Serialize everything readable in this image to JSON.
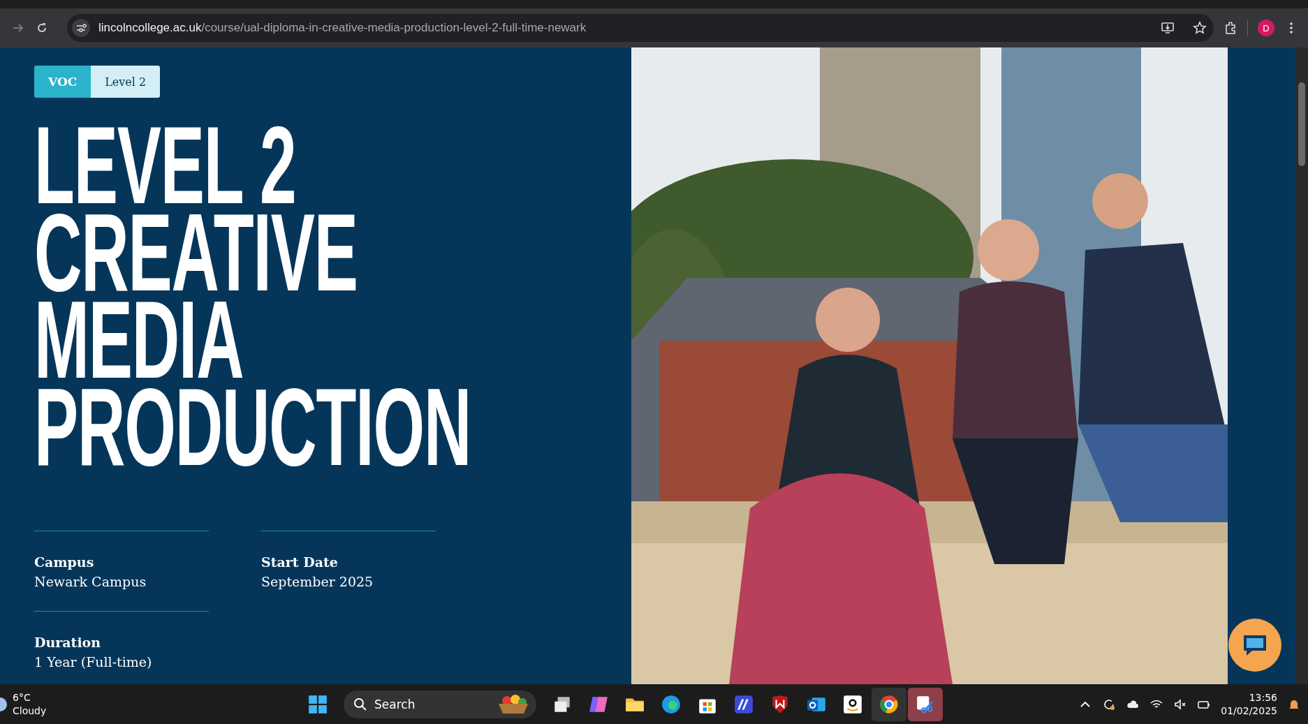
{
  "browser": {
    "url_domain": "lincolncollege.ac.uk",
    "url_path": "/course/ual-diploma-in-creative-media-production-level-2-full-time-newark",
    "profile_initial": "D"
  },
  "tags": [
    {
      "label": "VOC",
      "kind": "type"
    },
    {
      "label": "Level 2",
      "kind": "level"
    }
  ],
  "title": "LEVEL 2 CREATIVE MEDIA PRODUCTION",
  "details": [
    {
      "label": "Campus",
      "value": "Newark Campus"
    },
    {
      "label": "Start Date",
      "value": "September 2025"
    },
    {
      "label": "Duration",
      "value": "1 Year (Full-time)"
    }
  ],
  "taskbar": {
    "weather_temp": "6°C",
    "weather_desc": "Cloudy",
    "search_placeholder": "Search",
    "time": "13:56",
    "date": "01/02/2025"
  }
}
